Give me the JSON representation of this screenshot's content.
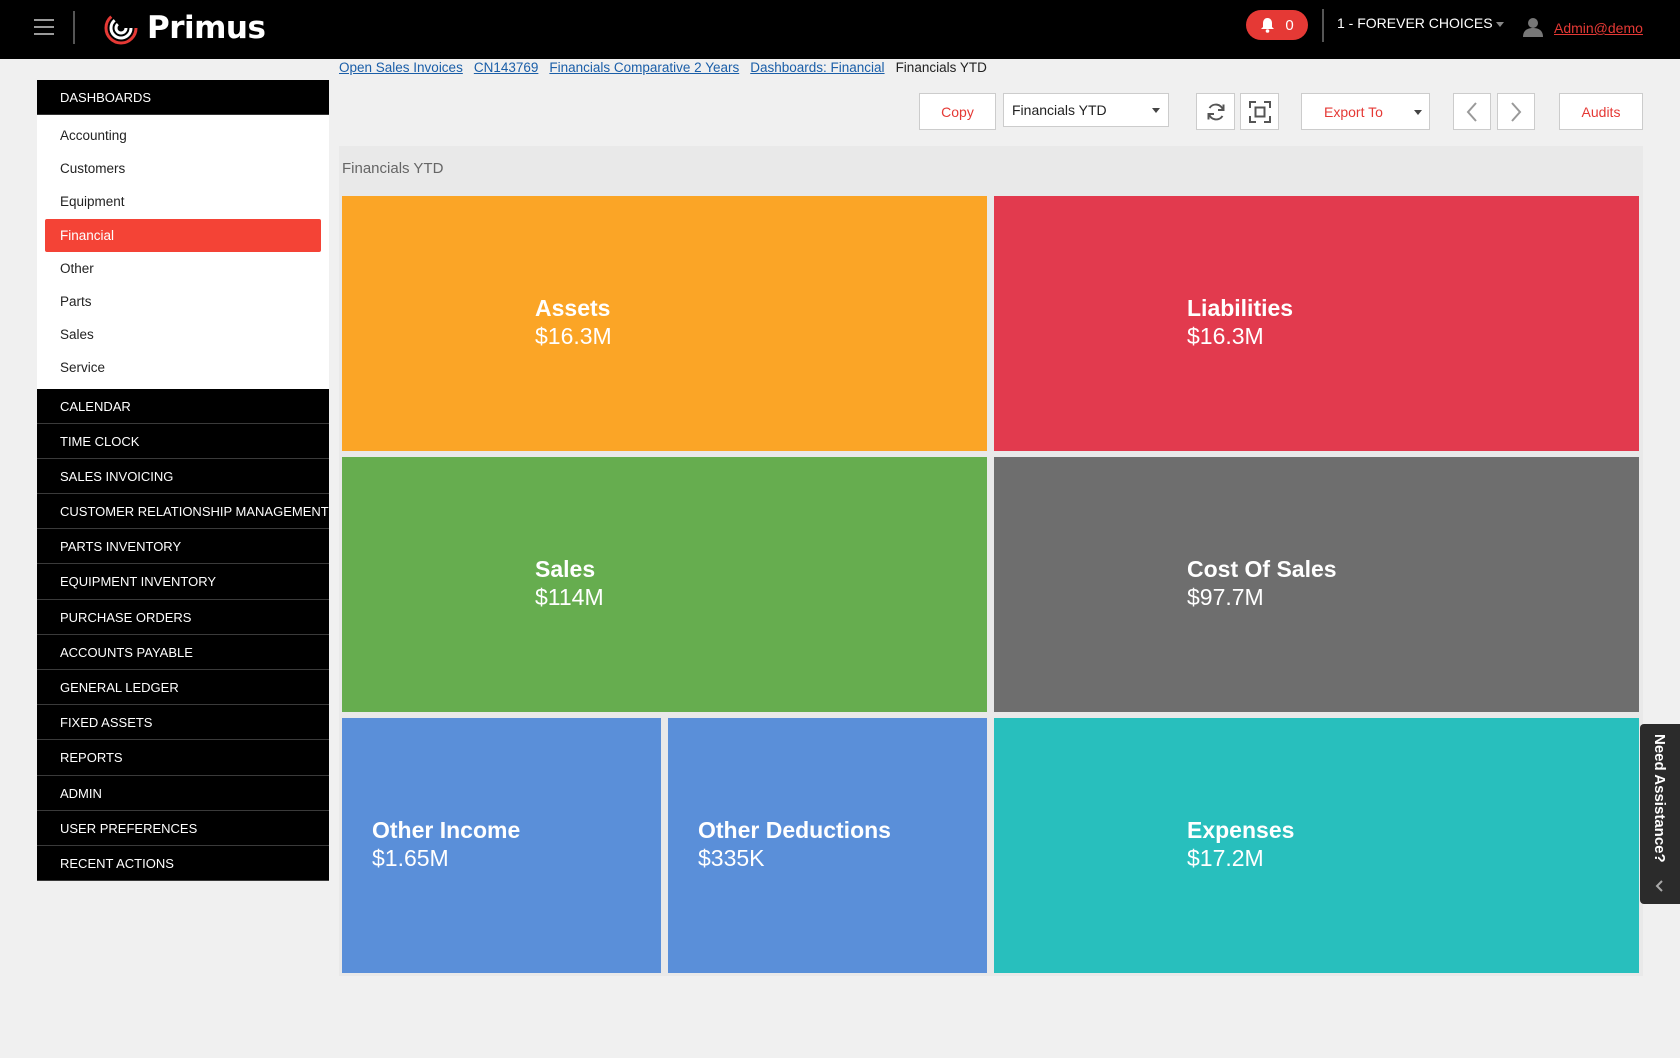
{
  "header": {
    "brand": "Primus",
    "notifications_count": "0",
    "company": "1 - FOREVER CHOICES",
    "user": "Admin@demo"
  },
  "breadcrumbs": {
    "links": [
      "Open Sales Invoices",
      "CN143769",
      "Financials Comparative 2 Years",
      "Dashboards: Financial"
    ],
    "current": "Financials YTD"
  },
  "sidebar": {
    "dashboards_label": "DASHBOARDS",
    "dashboard_items": [
      "Accounting",
      "Customers",
      "Equipment",
      "Financial",
      "Other",
      "Parts",
      "Sales",
      "Service"
    ],
    "active_item": "Financial",
    "sections": [
      "CALENDAR",
      "TIME CLOCK",
      "SALES INVOICING",
      "CUSTOMER RELATIONSHIP MANAGEMENT",
      "PARTS INVENTORY",
      "EQUIPMENT INVENTORY",
      "PURCHASE ORDERS",
      "ACCOUNTS PAYABLE",
      "GENERAL LEDGER",
      "FIXED ASSETS",
      "REPORTS",
      "ADMIN",
      "USER PREFERENCES",
      "RECENT ACTIONS"
    ]
  },
  "toolbar": {
    "copy_label": "Copy",
    "dashboard_select": "Financials YTD",
    "export_label": "Export To",
    "audits_label": "Audits"
  },
  "dashboard": {
    "title": "Financials YTD",
    "tiles": [
      {
        "label": "Assets",
        "value": "$16.3M",
        "color": "#FBA526"
      },
      {
        "label": "Liabilities",
        "value": "$16.3M",
        "color": "#E23A4E"
      },
      {
        "label": "Sales",
        "value": "$114M",
        "color": "#66AD4F"
      },
      {
        "label": "Cost Of Sales",
        "value": "$97.7M",
        "color": "#6E6E6E"
      },
      {
        "label": "Other Income",
        "value": "$1.65M",
        "color": "#5A8FD9"
      },
      {
        "label": "Other Deductions",
        "value": "$335K",
        "color": "#5A8FD9"
      },
      {
        "label": "Expenses",
        "value": "$17.2M",
        "color": "#28BFBD"
      }
    ]
  },
  "assistance": {
    "label": "Need Assistance?"
  },
  "colors": {
    "accent": "#e53935",
    "link": "#1a5ea8",
    "topbar": "#000000"
  }
}
